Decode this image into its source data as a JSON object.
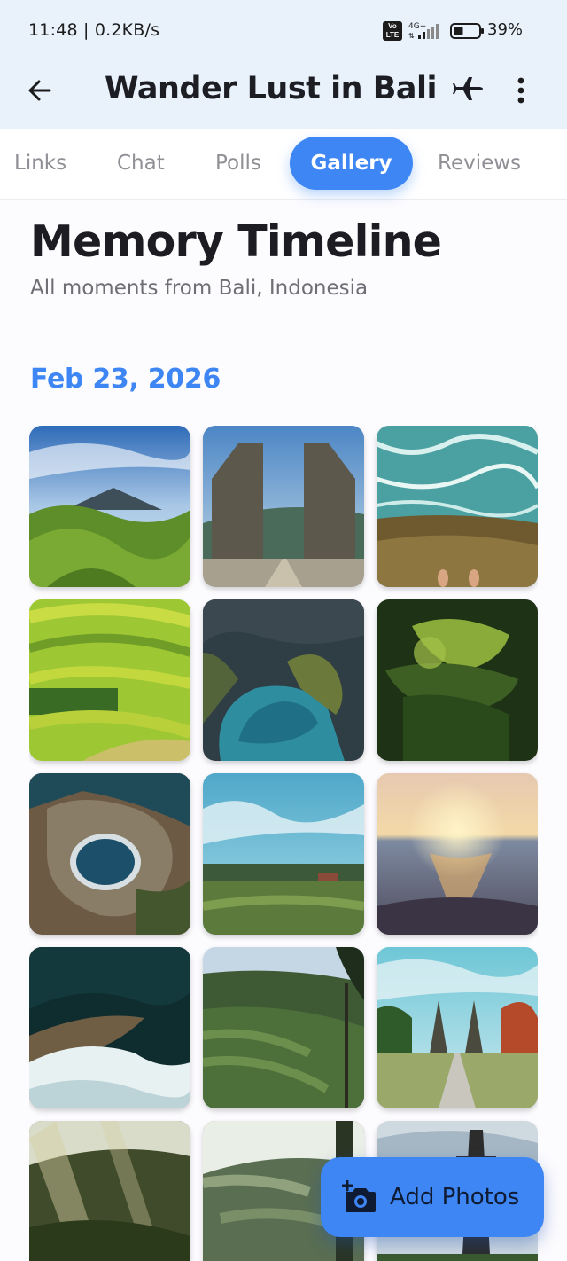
{
  "status_bar": {
    "time": "11:48 | 0.2KB/s",
    "volte_label": "Vo LTE",
    "network": "4G+",
    "battery_percent": "39%",
    "battery_level": 0.39
  },
  "app_bar": {
    "title": "Wander Lust in Bali",
    "back_icon": "arrow-left-icon",
    "title_icon": "airplane-icon",
    "menu_icon": "more-vertical-icon"
  },
  "tabs": [
    {
      "label": "Links",
      "active": false
    },
    {
      "label": "Chat",
      "active": false
    },
    {
      "label": "Polls",
      "active": false
    },
    {
      "label": "Gallery",
      "active": true
    },
    {
      "label": "Reviews",
      "active": false
    }
  ],
  "gallery": {
    "heading": "Memory Timeline",
    "subheading": "All moments from Bali, Indonesia",
    "date_group": "Feb 23, 2026",
    "photos": [
      "volcano-hills",
      "temple-gate",
      "ocean-rocks",
      "rice-terraces",
      "cliff-coast",
      "jungle-terraces",
      "aerial-lagoon",
      "rice-field-sky",
      "sunset-sea",
      "wave-aerial",
      "jungle-valley",
      "gate-road",
      "misty-forest",
      "sunlit-terrace",
      "pagoda-sky"
    ]
  },
  "fab": {
    "label": "Add Photos",
    "icon": "add-photo-icon"
  },
  "colors": {
    "accent": "#3d86f3",
    "header_bg": "#e9f1fb"
  }
}
